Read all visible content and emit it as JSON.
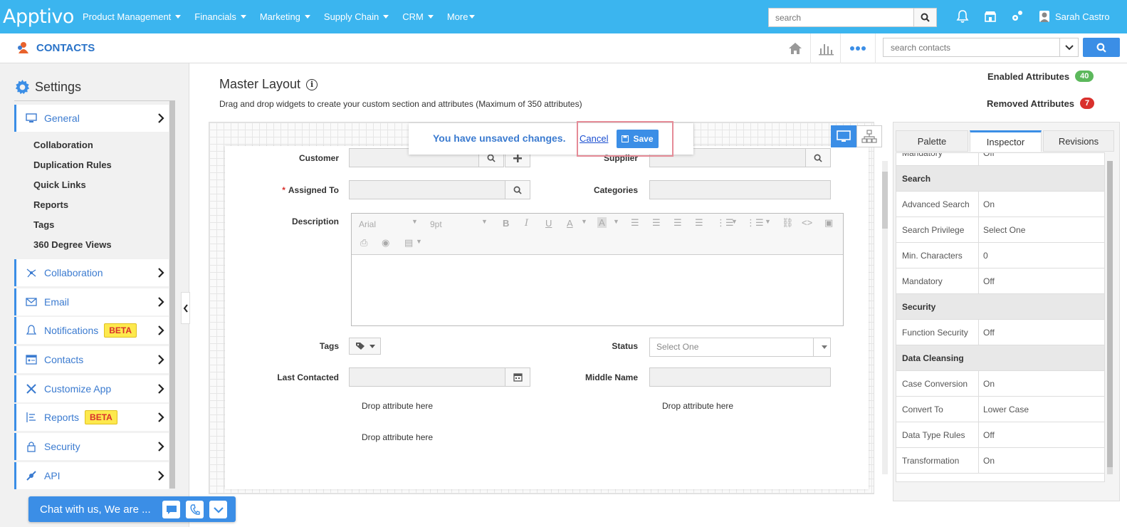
{
  "header": {
    "logo": "Apptivo",
    "nav": [
      "Product Management",
      "Financials",
      "Marketing",
      "Supply Chain",
      "CRM",
      "More"
    ],
    "search_placeholder": "search",
    "user_name": "Sarah Castro"
  },
  "subheader": {
    "app_name": "CONTACTS",
    "search_placeholder": "search contacts"
  },
  "sidebar": {
    "title": "Settings",
    "general": "General",
    "general_items": [
      "Collaboration",
      "Duplication Rules",
      "Quick Links",
      "Reports",
      "Tags",
      "360 Degree Views"
    ],
    "sections": [
      {
        "label": "Collaboration",
        "icon": "collaboration-icon"
      },
      {
        "label": "Email",
        "icon": "email-icon"
      },
      {
        "label": "Notifications",
        "icon": "bell-icon",
        "badge": "BETA"
      },
      {
        "label": "Contacts",
        "icon": "contacts-icon"
      },
      {
        "label": "Customize App",
        "icon": "tools-icon"
      },
      {
        "label": "Reports",
        "icon": "reports-icon",
        "badge": "BETA"
      },
      {
        "label": "Security",
        "icon": "lock-icon"
      },
      {
        "label": "API",
        "icon": "api-icon"
      }
    ]
  },
  "main": {
    "title": "Master Layout",
    "description": "Drag and drop widgets to create your custom section and attributes (Maximum of 350 attributes)",
    "enabled_label": "Enabled Attributes",
    "enabled_count": "40",
    "removed_label": "Removed Attributes",
    "removed_count": "7",
    "unsaved_msg": "You have unsaved changes.",
    "cancel": "Cancel",
    "save": "Save"
  },
  "form": {
    "customer": "Customer",
    "supplier": "Supplier",
    "assigned_to": "Assigned To",
    "categories": "Categories",
    "description": "Description",
    "font": "Arial",
    "size": "9pt",
    "tags": "Tags",
    "status": "Status",
    "status_value": "Select One",
    "last_contacted": "Last Contacted",
    "middle_name": "Middle Name",
    "drop_here": "Drop attribute here"
  },
  "inspector": {
    "tabs": [
      "Palette",
      "Inspector",
      "Revisions"
    ],
    "rows": [
      {
        "type": "row",
        "k": "Mandatory",
        "v": "Off"
      },
      {
        "type": "head",
        "k": "Search"
      },
      {
        "type": "row",
        "k": "Advanced Search",
        "v": "On"
      },
      {
        "type": "row",
        "k": "Search Privilege",
        "v": "Select One"
      },
      {
        "type": "row",
        "k": "Min. Characters",
        "v": "0"
      },
      {
        "type": "row",
        "k": "Mandatory",
        "v": "Off"
      },
      {
        "type": "head",
        "k": "Security"
      },
      {
        "type": "row",
        "k": "Function Security",
        "v": "Off"
      },
      {
        "type": "head",
        "k": "Data Cleansing"
      },
      {
        "type": "row",
        "k": "Case Conversion",
        "v": "On"
      },
      {
        "type": "row",
        "k": "Convert To",
        "v": "Lower Case"
      },
      {
        "type": "row",
        "k": "Data Type Rules",
        "v": "Off"
      },
      {
        "type": "row",
        "k": "Transformation",
        "v": "On"
      }
    ]
  },
  "chat": {
    "text": "Chat with us, We are ..."
  },
  "colors": {
    "header_bg": "#3bb5ef",
    "accent": "#3b8ee6",
    "enabled_badge": "#5cb85c",
    "removed_badge": "#d9302c"
  }
}
